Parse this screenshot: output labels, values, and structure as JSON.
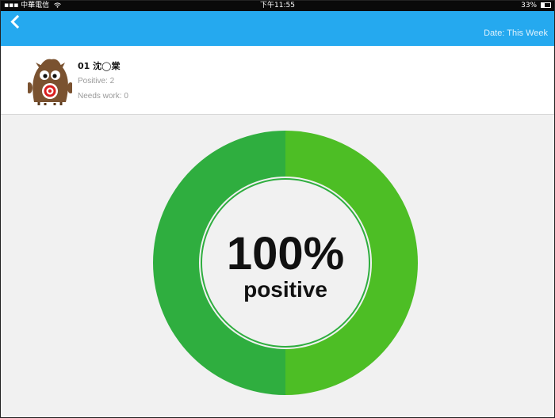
{
  "status_bar": {
    "carrier": "中華電信",
    "time": "下午11:55",
    "battery": "33%"
  },
  "nav": {
    "back_icon": "chevron-left-icon",
    "date_filter": "Date: This Week"
  },
  "student": {
    "name": "01 沈◯棠",
    "positive": "Positive: 2",
    "needs_work": "Needs work: 0",
    "avatar_icon": "monster-avatar-icon"
  },
  "chart_data": {
    "type": "pie",
    "center_value": "100%",
    "center_label": "positive",
    "series": [
      {
        "name": "Positive",
        "value": 2,
        "color": "#4dbe25"
      },
      {
        "name": "Needs work",
        "value": 0,
        "color": "#e2e2e2"
      }
    ]
  },
  "colors": {
    "nav_blue": "#25a9ef",
    "ring_green_light": "#4dbe25",
    "ring_green_dark": "#2fae3f"
  }
}
